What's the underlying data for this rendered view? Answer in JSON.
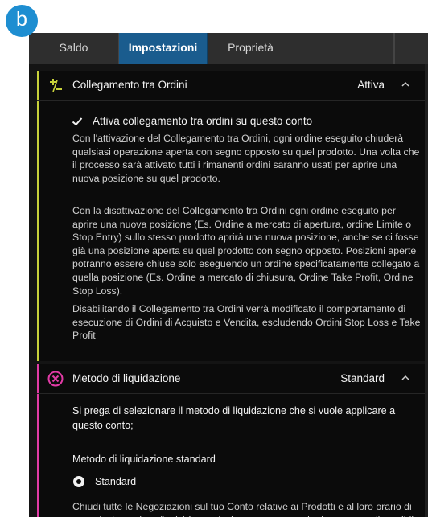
{
  "badge": {
    "letter": "b",
    "color": "#1e8ed1"
  },
  "tabs": [
    {
      "label": "Saldo",
      "active": false
    },
    {
      "label": "Impostazioni",
      "active": true
    },
    {
      "label": "Proprietà",
      "active": false
    }
  ],
  "sections": [
    {
      "title": "Collegamento tra Ordini",
      "status": "Attiva",
      "accent_color": "#c8d23a",
      "icon": "plus-minus-icon",
      "chevron": "chevron-up-icon",
      "checkbox": {
        "label": "Attiva collegamento tra ordini su questo conto",
        "checked": true
      },
      "paragraphs": [
        "Con l'attivazione del Collegamento tra Ordini, ogni ordine eseguito chiuderà qualsiasi operazione aperta con segno opposto su quel prodotto. Una volta che il processo sarà attivato tutti i rimanenti ordini saranno usati per aprire una nuova posizione su quel prodotto.",
        "Con la disattivazione del Collegamento tra Ordini ogni ordine eseguito per aprire una nuova posizione (Es. Ordine a mercato di apertura, ordine Limite o Stop Entry) sullo stesso prodotto aprirà una nuova posizione, anche se ci fosse già una posizione aperta su quel prodotto con segno opposto. Posizioni aperte potranno essere chiuse solo eseguendo un ordine specificatamente collegato a quella posizione (Es. Ordine a mercato di chiusura, Ordine Take Profit, Ordine Stop Loss).",
        "Disabilitando il Collegamento tra Ordini verrà modificato il comportamento di esecuzione di Ordini di Acquisto e Vendita, escludendo Ordini Stop Loss e Take Profit"
      ]
    },
    {
      "title": "Metodo di liquidazione",
      "status": "Standard",
      "accent_color": "#e23ba6",
      "icon": "close-circle-icon",
      "chevron": "chevron-up-icon",
      "intro": "Si prega di selezionare il metodo di liquidazione che si vuole applicare a questo conto;",
      "subheading": "Metodo di liquidazione standard",
      "radio": {
        "label": "Standard",
        "selected": true
      },
      "description": "Chiudi tutte le Negoziazioni sul tuo Conto relative ai Prodotti e al loro orario di negoziazione, dove l'attività non risultasse sospesa, al primo prezzo disponibile"
    }
  ]
}
